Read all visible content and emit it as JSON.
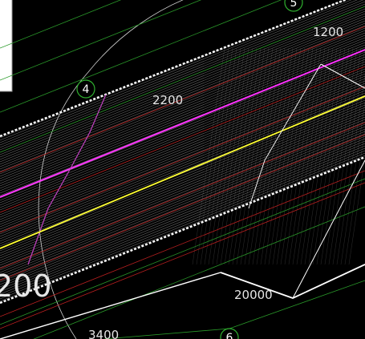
{
  "colors": {
    "background": "#000000",
    "hatch": "#d9d9d9",
    "outline": "#ffffff",
    "centerline_magenta": "#ff33ff",
    "centerline_yellow": "#ffff33",
    "grid_green": "#2faf2f",
    "red_lines": "#cc2222",
    "arc": "#cfcfcf"
  },
  "drawing": {
    "grid_bubbles": [
      "4",
      "5",
      "6"
    ],
    "dimensions": {
      "top_right": "1200",
      "upper_mid": "2200",
      "left_large": "200",
      "bottom_mid": "20000",
      "bottom_left": "3400"
    }
  }
}
